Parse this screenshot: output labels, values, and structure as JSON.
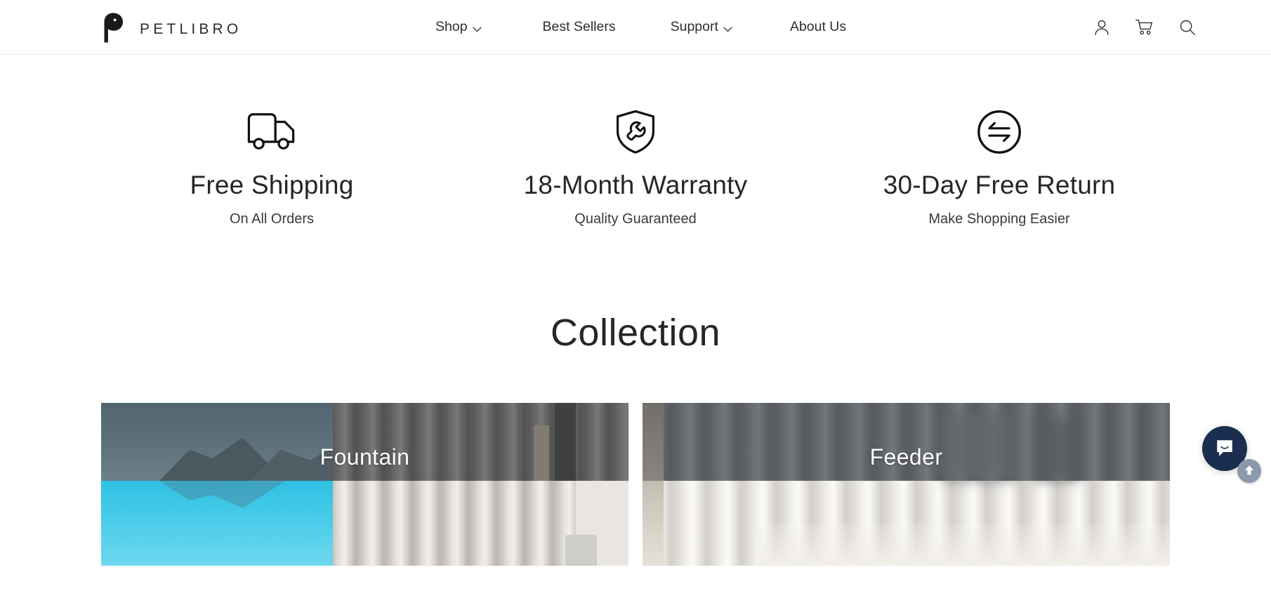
{
  "brand": {
    "name": "PETLIBRO",
    "logo_icon": "petlibro-p-mark-icon"
  },
  "header": {
    "nav": [
      {
        "label": "Shop",
        "has_dropdown": true,
        "caret_icon": "chevron-down-icon"
      },
      {
        "label": "Best Sellers",
        "has_dropdown": false
      },
      {
        "label": "Support",
        "has_dropdown": true,
        "caret_icon": "chevron-down-icon"
      },
      {
        "label": "About Us",
        "has_dropdown": false
      }
    ],
    "actions": [
      {
        "name": "account",
        "icon": "user-icon"
      },
      {
        "name": "cart",
        "icon": "shopping-cart-icon"
      },
      {
        "name": "search",
        "icon": "search-icon"
      }
    ]
  },
  "features": [
    {
      "icon": "delivery-truck-icon",
      "title": "Free Shipping",
      "subtitle": "On All Orders"
    },
    {
      "icon": "shield-wrench-icon",
      "title": "18-Month Warranty",
      "subtitle": "Quality Guaranteed"
    },
    {
      "icon": "return-exchange-arrows-icon",
      "title": "30-Day Free Return",
      "subtitle": "Make Shopping Easier"
    }
  ],
  "collection": {
    "heading": "Collection",
    "cards": [
      {
        "label": "Fountain"
      },
      {
        "label": "Feeder"
      }
    ]
  },
  "widgets": {
    "chat": {
      "icon": "chat-bubble-smile-icon",
      "color": "#1c2e4f"
    },
    "back_to_top": {
      "icon": "arrow-up-icon",
      "color": "#8b99aa"
    }
  },
  "colors": {
    "text_primary": "#262626",
    "text_secondary": "#3a3a3a",
    "page_background": "#ffffff",
    "header_border": "#e9e9e9",
    "card_label": "#ffffff"
  }
}
